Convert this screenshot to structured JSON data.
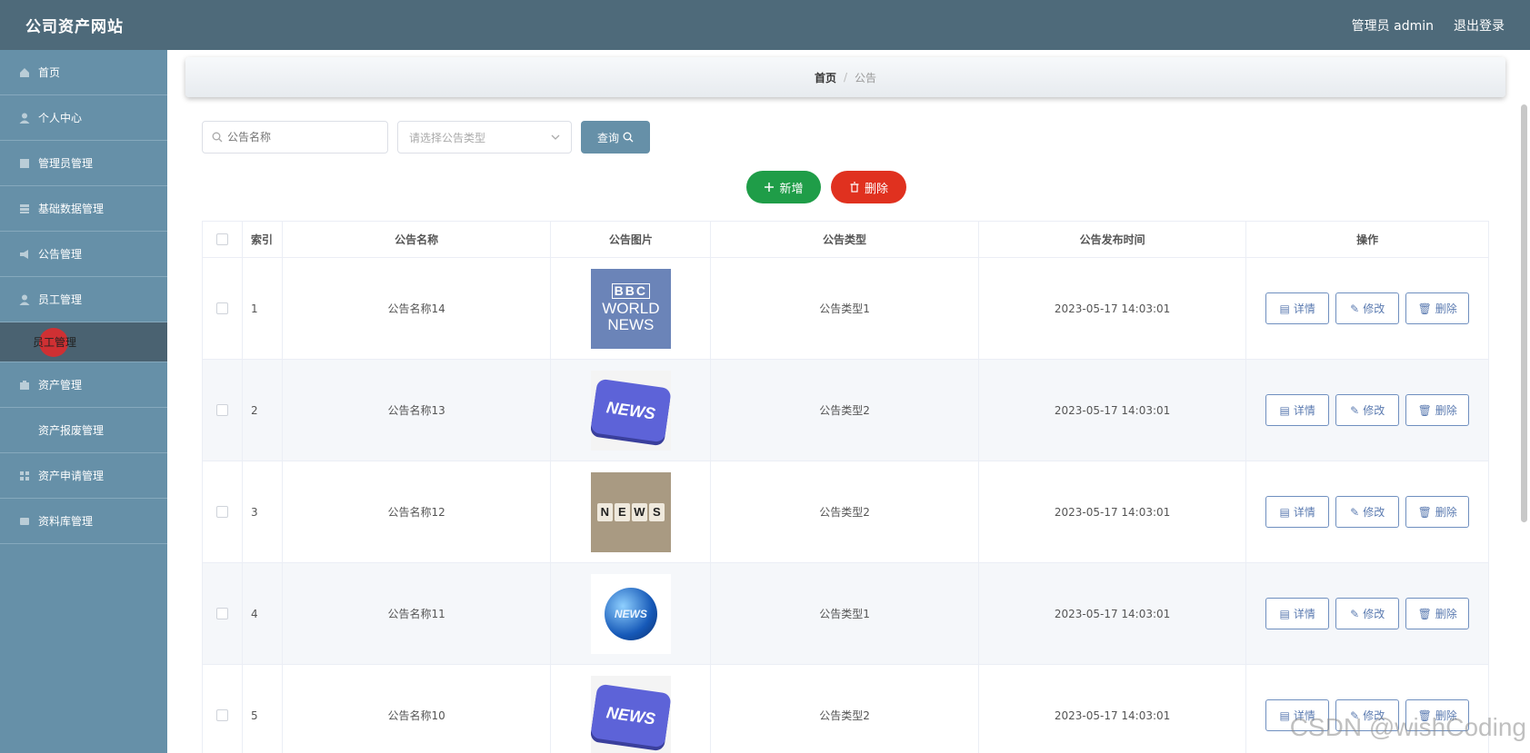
{
  "header": {
    "title": "公司资产网站",
    "user_label": "管理员 admin",
    "logout_label": "退出登录"
  },
  "sidebar": {
    "items": [
      {
        "label": "首页"
      },
      {
        "label": "个人中心"
      },
      {
        "label": "管理员管理"
      },
      {
        "label": "基础数据管理"
      },
      {
        "label": "公告管理"
      },
      {
        "label": "员工管理"
      }
    ],
    "sub_item": {
      "label": "员工管理"
    },
    "items_after": [
      {
        "label": "资产管理"
      },
      {
        "label": "资产报废管理"
      },
      {
        "label": "资产申请管理"
      },
      {
        "label": "资料库管理"
      }
    ]
  },
  "breadcrumb": {
    "home": "首页",
    "separator": "/",
    "current": "公告"
  },
  "search": {
    "name_placeholder": "公告名称",
    "type_placeholder": "请选择公告类型",
    "search_label": "查询"
  },
  "actions": {
    "add_label": "新增",
    "delete_label": "删除"
  },
  "table": {
    "headers": {
      "index": "索引",
      "name": "公告名称",
      "image": "公告图片",
      "type": "公告类型",
      "time": "公告发布时间",
      "ops": "操作"
    },
    "op_labels": {
      "detail": "详情",
      "edit": "修改",
      "delete": "删除"
    },
    "rows": [
      {
        "index": "1",
        "name": "公告名称14",
        "type": "公告类型1",
        "time": "2023-05-17 14:03:01"
      },
      {
        "index": "2",
        "name": "公告名称13",
        "type": "公告类型2",
        "time": "2023-05-17 14:03:01"
      },
      {
        "index": "3",
        "name": "公告名称12",
        "type": "公告类型2",
        "time": "2023-05-17 14:03:01"
      },
      {
        "index": "4",
        "name": "公告名称11",
        "type": "公告类型1",
        "time": "2023-05-17 14:03:01"
      },
      {
        "index": "5",
        "name": "公告名称10",
        "type": "公告类型2",
        "time": "2023-05-17 14:03:01"
      }
    ]
  },
  "thumbnails": {
    "bbc": {
      "line1": "BBC",
      "line2": "WORLD",
      "line3": "NEWS"
    },
    "key": "NEWS",
    "dice": [
      "N",
      "E",
      "W",
      "S"
    ],
    "globe": "NEWS"
  },
  "watermark": "CSDN @wishCoding",
  "colors": {
    "topbar": "#4e6a7a",
    "sidebar": "#6690a8",
    "add_button": "#1f9d48",
    "delete_button": "#e0311f"
  }
}
